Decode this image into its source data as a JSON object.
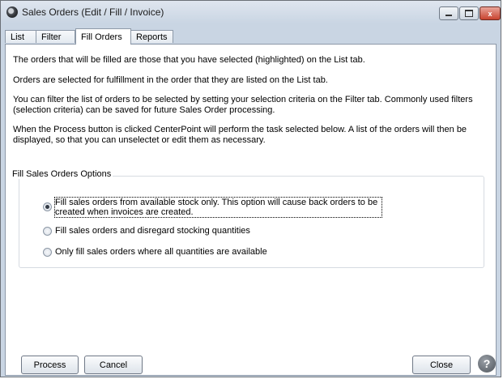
{
  "window": {
    "title": "Sales Orders (Edit / Fill / Invoice)",
    "controls": {
      "minimize_icon": "minimize-icon",
      "maximize_icon": "maximize-icon",
      "close_label": "x"
    }
  },
  "tabs": [
    {
      "label": "List",
      "active": false
    },
    {
      "label": "Filter",
      "active": false
    },
    {
      "label": "Fill Orders",
      "active": true
    },
    {
      "label": "Reports",
      "active": false
    }
  ],
  "info": [
    "The orders that will be filled are those that you have selected (highlighted) on the List tab.",
    "Orders are selected for fulfillment in the order that they are listed on the List tab.",
    "You can filter the list of orders to be selected by setting your selection criteria on the Filter tab.  Commonly used filters (selection criteria) can be saved for future Sales Order processing.",
    "When the Process button is clicked CenterPoint will perform the task selected below.  A list of the orders will then be displayed, so that you can unselectet or edit them as necessary."
  ],
  "options_group": {
    "label": "Fill Sales Orders Options",
    "options": [
      {
        "label": "Fill sales orders from available stock only.  This option will cause back orders to be created when invoices are created.",
        "checked": true
      },
      {
        "label": "Fill sales orders and disregard stocking quantities",
        "checked": false
      },
      {
        "label": "Only fill sales orders where all quantities are available",
        "checked": false
      }
    ]
  },
  "buttons": {
    "process": "Process",
    "cancel": "Cancel",
    "close": "Close",
    "help": "?"
  }
}
